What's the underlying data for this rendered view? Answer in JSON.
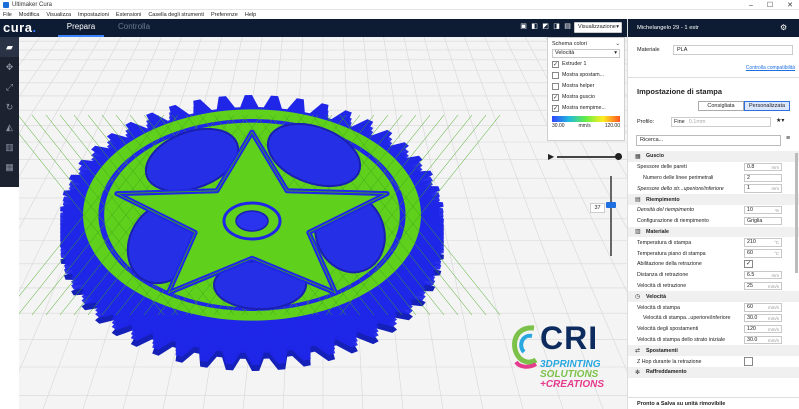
{
  "window": {
    "title": "Ultimaker Cura",
    "controls": [
      "–",
      "☐",
      "✕"
    ]
  },
  "menu": [
    "File",
    "Modifica",
    "Visualizza",
    "Impostazioni",
    "Estensioni",
    "Casella degli strumenti",
    "Preferenze",
    "Help"
  ],
  "header": {
    "logo": "cura",
    "tabs": [
      "Prepara",
      "Controlla"
    ],
    "view_select": "Visualizzazione ..."
  },
  "color_scheme": {
    "label": "Schema colori",
    "selected": "Velocità",
    "items": [
      {
        "label": "Extruder 1",
        "checked": true
      },
      {
        "label": "Mostra spostam...",
        "checked": false
      },
      {
        "label": "Mostra helper",
        "checked": false
      },
      {
        "label": "Mostra guscio",
        "checked": true
      },
      {
        "label": "Mostra riempime...",
        "checked": true
      }
    ],
    "legend_min": "30.00",
    "legend_unit": "mm/s",
    "legend_max": "120.00"
  },
  "layer": {
    "current": "37"
  },
  "panel": {
    "printer": "Michelangelo 29 - 1 estr",
    "material_label": "Materiale",
    "material_value": "PLA",
    "compat_link": "Controlla compatibilità",
    "print_settings_title": "Impostazione di stampa",
    "tab_recommended": "Consigliata",
    "tab_custom": "Personalizzata",
    "profile_label": "Profilo:",
    "profile_value": "Fine",
    "profile_sub": "0.1mm",
    "search_placeholder": "Ricerca...",
    "bottom_text": "Pronto a Salva su unità rimovibile"
  },
  "settings": [
    {
      "type": "cat",
      "icon": "▦",
      "label": "Guscio"
    },
    {
      "label": "Spessore delle pareti",
      "value": "0.8",
      "unit": "mm"
    },
    {
      "label": "Numero delle linee perimetrali",
      "value": "2",
      "indent": true
    },
    {
      "label": "Spessore dello str...uperiore/inferiore",
      "value": "1",
      "unit": "mm",
      "italic": true
    },
    {
      "type": "cat",
      "icon": "▤",
      "label": "Riempimento"
    },
    {
      "label": "Densità del riempimento",
      "value": "10",
      "unit": "%",
      "italic": true
    },
    {
      "label": "Configurazione di riempimento",
      "value": "Griglia"
    },
    {
      "type": "cat",
      "icon": "▥",
      "label": "Materiale"
    },
    {
      "label": "Temperatura di stampa",
      "value": "210",
      "unit": "°C"
    },
    {
      "label": "Temperatura piano di stampa",
      "value": "60",
      "unit": "°C"
    },
    {
      "label": "Abilitazione della retrazione",
      "check": true
    },
    {
      "label": "Distanza di retrazione",
      "value": "6.5",
      "unit": "mm"
    },
    {
      "label": "Velocità di retrazione",
      "value": "25",
      "unit": "mm/s"
    },
    {
      "type": "cat",
      "icon": "◷",
      "label": "Velocità"
    },
    {
      "label": "Velocità di stampa",
      "value": "60",
      "unit": "mm/s"
    },
    {
      "label": "Velocità di stampa...uperiore/inferiore",
      "value": "30.0",
      "unit": "mm/s",
      "indent": true
    },
    {
      "label": "Velocità degli spostamenti",
      "value": "120",
      "unit": "mm/s"
    },
    {
      "label": "Velocità di stampa dello strato iniziale",
      "value": "30.0",
      "unit": "mm/s"
    },
    {
      "type": "cat",
      "icon": "⇄",
      "label": "Spostamenti"
    },
    {
      "label": "Z Hop durante la retrazione",
      "check": false
    },
    {
      "type": "cat",
      "icon": "✻",
      "label": "Raffreddamento"
    }
  ],
  "watermark": {
    "brand": "CRI",
    "line1": "3DPRINTING",
    "line2": "SOLUTIONS",
    "line3": "+CREATIONS"
  },
  "colors": {
    "shell": "#1f26e8",
    "infill": "#5fd11c",
    "header": "#0d1b33",
    "accent": "#3c82ff"
  }
}
